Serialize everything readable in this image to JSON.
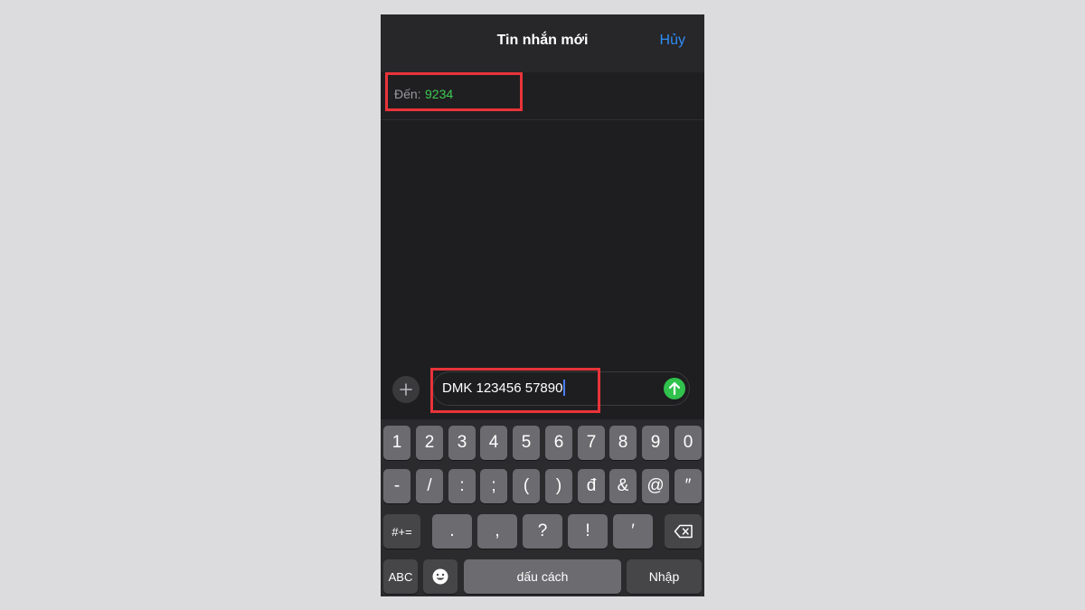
{
  "navbar": {
    "title": "Tin nhắn mới",
    "cancel_label": "Hủy"
  },
  "recipient": {
    "label": "Đến:",
    "value": "9234"
  },
  "compose": {
    "message_value": "DMK 123456 57890"
  },
  "keyboard": {
    "row1": [
      "1",
      "2",
      "3",
      "4",
      "5",
      "6",
      "7",
      "8",
      "9",
      "0"
    ],
    "row2": [
      "-",
      "/",
      ":",
      ";",
      "(",
      ")",
      "đ",
      "&",
      "@",
      "″"
    ],
    "row3": {
      "symbols_label": "#+=",
      "keys": [
        ".",
        ",",
        "?",
        "!",
        "′"
      ]
    },
    "row4": {
      "abc_label": "ABC",
      "space_label": "dấu cách",
      "return_label": "Nhập"
    }
  },
  "colors": {
    "accent_blue": "#2f8cf6",
    "recipient_green": "#3fcb53",
    "send_green": "#30c24c",
    "highlight_red": "#e8333a"
  }
}
